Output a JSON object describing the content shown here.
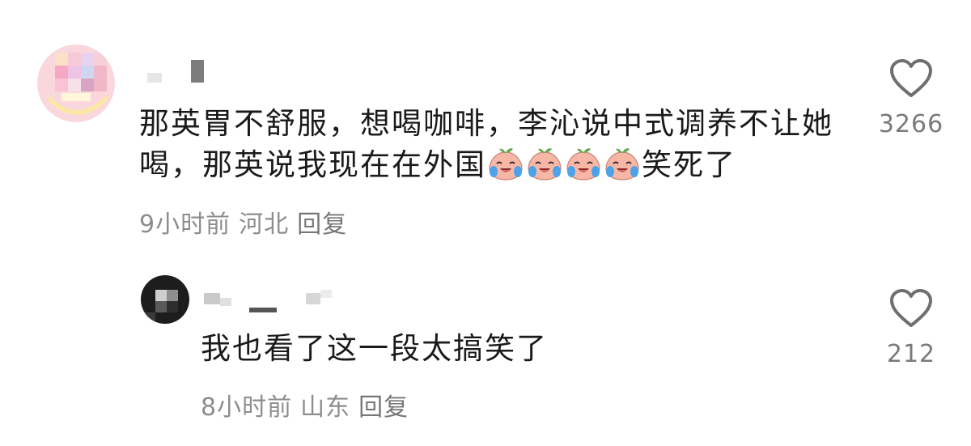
{
  "comments": [
    {
      "text_part1": "那英胃不舒服，想喝咖啡，李沁说中式调养不让她喝，那英说我现在在外国",
      "emoji_count": 4,
      "emoji_name": "laugh-cry-peach-emoji",
      "text_part2": "笑死了",
      "time": "9小时前",
      "location": "河北",
      "reply_label": "回复",
      "like_count": "3266"
    },
    {
      "text_part1": "我也看了这一段太搞笑了",
      "time": "8小时前",
      "location": "山东",
      "reply_label": "回复",
      "like_count": "212"
    }
  ],
  "colors": {
    "text": "#1a1a1a",
    "meta": "#8d8d8d",
    "icon": "#6f6f6f",
    "peach": "#f6b7a7",
    "leaf": "#5fa84e",
    "tear": "#4da3e8"
  }
}
